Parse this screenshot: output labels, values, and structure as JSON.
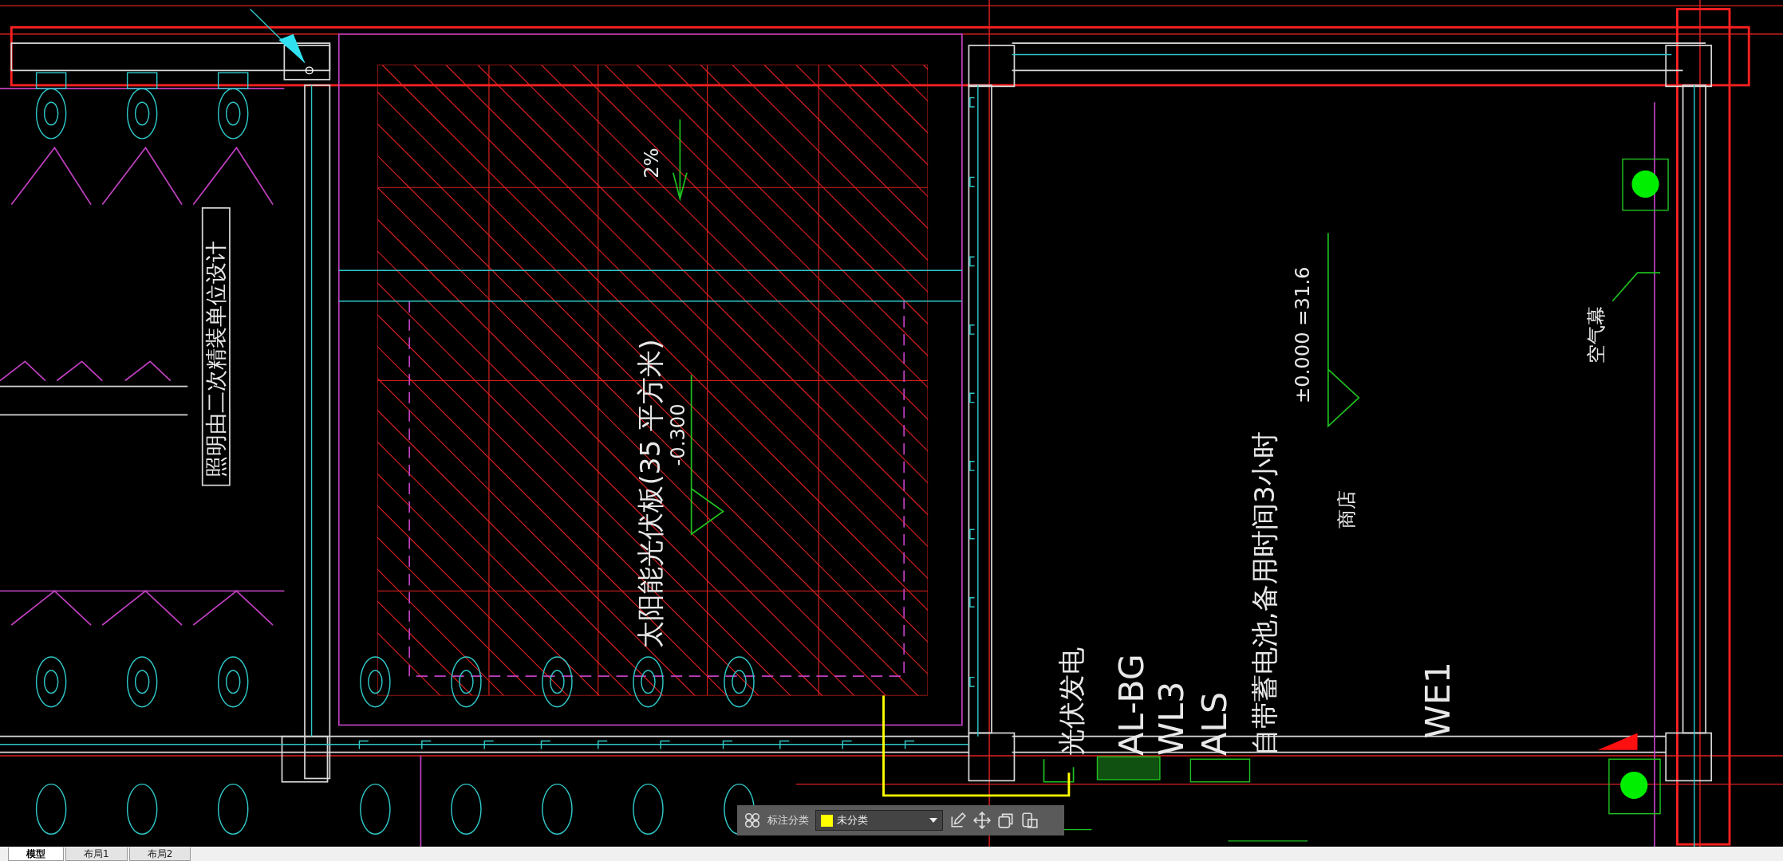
{
  "drawing": {
    "annotations": [
      {
        "kind": "boxed",
        "text": "照明由二次精装单位设计"
      },
      {
        "kind": "label",
        "text": "太阳能光伏板(35 平方米)"
      },
      {
        "kind": "small",
        "text": "-0.300"
      },
      {
        "kind": "small",
        "text": "2%"
      },
      {
        "kind": "small",
        "text": "±0.000 =31.6"
      },
      {
        "kind": "small",
        "text": "商店"
      },
      {
        "kind": "label",
        "text": "自带蓄电池,备用时间3小时"
      },
      {
        "kind": "big",
        "text": "ALS"
      },
      {
        "kind": "big",
        "text": "WL3"
      },
      {
        "kind": "big",
        "text": "AL-BG"
      },
      {
        "kind": "label",
        "text": "光伏发电"
      },
      {
        "kind": "big",
        "text": "WE1"
      },
      {
        "kind": "small",
        "text": "空气幕"
      }
    ]
  },
  "annotation_toolbar": {
    "label": "标注分类",
    "category": {
      "value": "未分类",
      "color": "#ffff00"
    }
  },
  "tabs": [
    {
      "label": "模型",
      "selected": true
    },
    {
      "label": "布局1",
      "selected": false
    },
    {
      "label": "布局2",
      "selected": false
    }
  ]
}
